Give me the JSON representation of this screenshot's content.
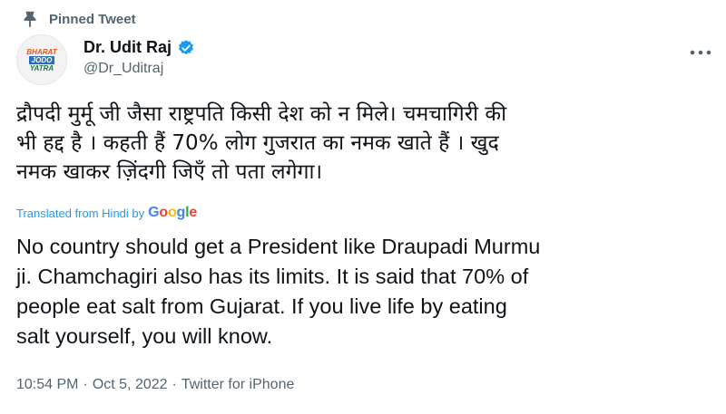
{
  "pinned": {
    "label": "Pinned Tweet",
    "icon": "pin-icon"
  },
  "author": {
    "display_name": "Dr. Udit Raj",
    "handle": "@Dr_Uditraj",
    "verified": true,
    "avatar_lines": [
      "BHARAT",
      "JODO",
      "YATRA"
    ]
  },
  "tweet": {
    "original_text": "द्रौपदी मुर्मू जी जैसा राष्ट्रपति किसी देश को न मिले। चमचागिरी की\nभी हद्द है । कहती हैं 70% लोग गुजरात का नमक खाते हैं । खुद\nनमक खाकर ज़िंदगी जिएँ तो पता लगेगा।",
    "translated_label": "Translated from Hindi by",
    "translation_provider": "Google",
    "translation_text": "No country should get a President like Draupadi Murmu\nji. Chamchagiri also has its limits. It is said that 70% of\npeople eat salt from Gujarat. If you live life by eating\nsalt yourself, you will know."
  },
  "meta": {
    "time": "10:54 PM",
    "separator": "·",
    "date": "Oct 5, 2022",
    "source": "Twitter for iPhone"
  },
  "colors": {
    "accent": "#1d9bf0",
    "secondary_text": "#536471",
    "primary_text": "#0f1419"
  }
}
